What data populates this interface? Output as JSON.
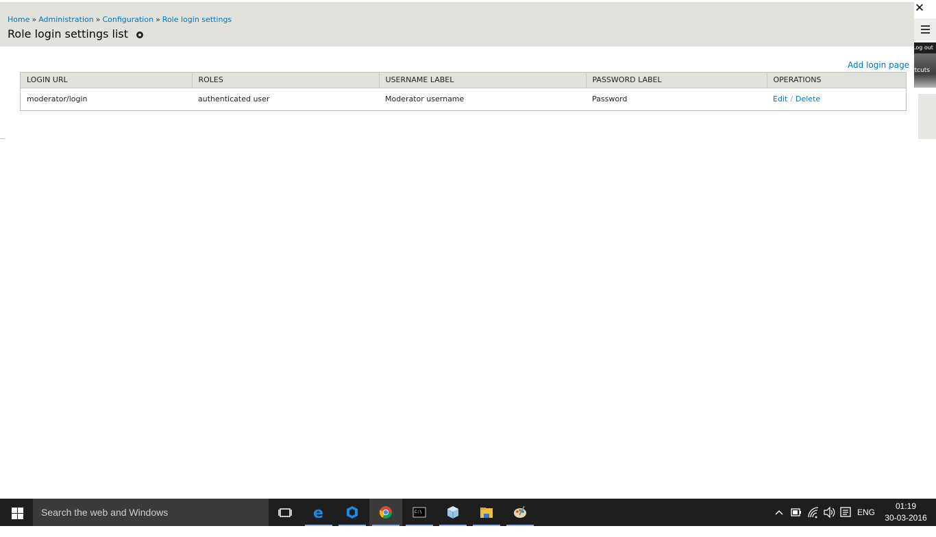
{
  "breadcrumb": {
    "items": [
      "Home",
      "Administration",
      "Configuration",
      "Role login settings"
    ],
    "separator": "»"
  },
  "page": {
    "title": "Role login settings list",
    "add_link": "Add login page"
  },
  "toolbar": {
    "close_glyph": "✕",
    "logout_label": "Log out",
    "shortcuts_label": "Shortcuts"
  },
  "table": {
    "columns": [
      "LOGIN URL",
      "ROLES",
      "USERNAME LABEL",
      "PASSWORD LABEL",
      "OPERATIONS"
    ],
    "rows": [
      {
        "login_url": "moderator/login",
        "roles": "authenticated user",
        "username_label": "Moderator username",
        "password_label": "Password",
        "edit": "Edit",
        "delete": "Delete"
      }
    ]
  },
  "taskbar": {
    "search_placeholder": "Search the web and Windows",
    "language": "ENG",
    "time": "01:19",
    "date": "30-03-2016"
  },
  "colors": {
    "link": "#0074bd",
    "header_bg": "#e1e2dc",
    "taskbar_bg": "#1e1e1e"
  }
}
